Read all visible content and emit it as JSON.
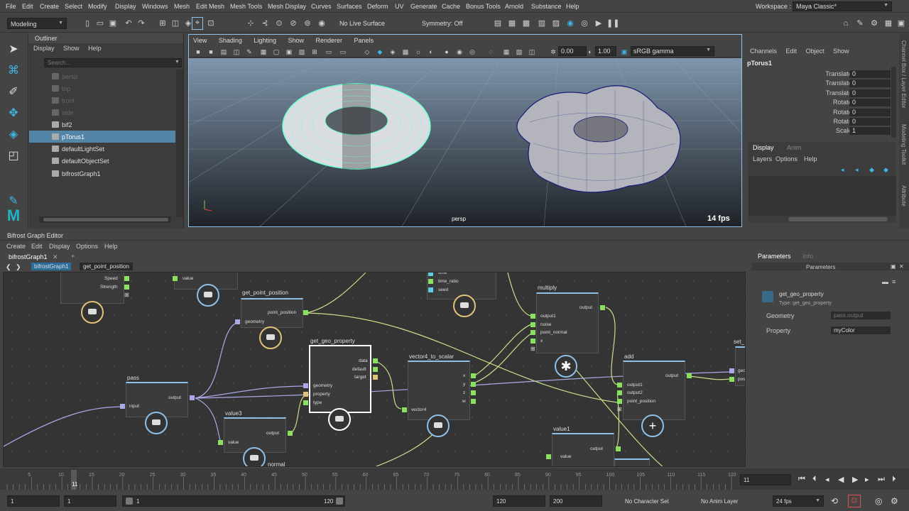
{
  "menubar": {
    "items": [
      "File",
      "Edit",
      "Create",
      "Select",
      "Modify",
      "Display",
      "Windows",
      "Mesh",
      "Edit Mesh",
      "Mesh Tools",
      "Mesh Display",
      "Curves",
      "Surfaces",
      "Deform",
      "UV",
      "Generate",
      "Cache",
      "Bonus Tools",
      "Arnold",
      "Substance",
      "Help"
    ],
    "workspace_label": "Workspace :",
    "workspace_value": "Maya Classic*"
  },
  "toolbar": {
    "mode": "Modeling",
    "live_surface": "No Live Surface",
    "symmetry": "Symmetry: Off"
  },
  "outliner": {
    "title": "Outliner",
    "menu": [
      "Display",
      "Show",
      "Help"
    ],
    "search_placeholder": "Search...",
    "items": [
      {
        "label": "persp",
        "dim": true
      },
      {
        "label": "top",
        "dim": true
      },
      {
        "label": "front",
        "dim": true
      },
      {
        "label": "side",
        "dim": true
      },
      {
        "label": "bif2",
        "dim": false
      },
      {
        "label": "pTorus1",
        "dim": false,
        "selected": true
      },
      {
        "label": "defaultLightSet",
        "dim": false
      },
      {
        "label": "defaultObjectSet",
        "dim": false
      },
      {
        "label": "bifrostGraph1",
        "dim": false
      }
    ]
  },
  "viewport": {
    "menu": [
      "View",
      "Shading",
      "Lighting",
      "Show",
      "Renderer",
      "Panels"
    ],
    "exposure": "0.00",
    "gamma": "1.00",
    "color_space": "sRGB gamma",
    "camera_label": "persp",
    "fps": "14 fps"
  },
  "channel_box": {
    "menu": [
      "Channels",
      "Edit",
      "Object",
      "Show"
    ],
    "object": "pTorus1",
    "channels": [
      {
        "label": "Translate X",
        "value": "0"
      },
      {
        "label": "Translate Y",
        "value": "0"
      },
      {
        "label": "Translate Z",
        "value": "0"
      },
      {
        "label": "Rotate X",
        "value": "0"
      },
      {
        "label": "Rotate Y",
        "value": "0"
      },
      {
        "label": "Rotate Z",
        "value": "0"
      },
      {
        "label": "Scale X",
        "value": "1"
      }
    ],
    "layer_tabs": [
      "Display",
      "Anim"
    ],
    "layer_menu": [
      "Layers",
      "Options",
      "Help"
    ],
    "side_tabs": [
      "Channel Box / Layer Editor",
      "Modeling Toolkit",
      "Attribute"
    ]
  },
  "bifrost": {
    "title": "Bifrost Graph Editor",
    "menu": [
      "Create",
      "Edit",
      "Display",
      "Options",
      "Help"
    ],
    "tab": "bifrostGraph1",
    "tab_add": "+",
    "breadcrumb": [
      "bifrostGraph1",
      "get_point_position"
    ],
    "nodes": {
      "n0_ports": [
        "Speed",
        "Strength"
      ],
      "value_port": "value",
      "get_point_position": {
        "title": "get_point_position",
        "out": "point_position",
        "in": "geometry"
      },
      "time_node": {
        "ports": [
          "time",
          "time_ratio",
          "seed"
        ]
      },
      "multiply": {
        "title": "multiply",
        "out": "output",
        "ins": [
          "output1",
          "noise",
          "point_normal",
          "x"
        ]
      },
      "get_geo_property": {
        "title": "get_geo_property",
        "outs": [
          "data",
          "default",
          "target"
        ],
        "ins": [
          "geometry",
          "property",
          "type"
        ]
      },
      "vector4_to_scalar": {
        "title": "vector4_to_scalar",
        "in": "vector4",
        "outs": [
          "x",
          "y",
          "z",
          "w"
        ]
      },
      "add": {
        "title": "add",
        "out": "output",
        "ins": [
          "output1",
          "output2",
          "point_position"
        ]
      },
      "set_node": {
        "title": "set_",
        "ports": [
          "geo",
          "pos"
        ]
      },
      "pass": {
        "title": "pass",
        "in": "input",
        "out": "output"
      },
      "value3": {
        "title": "value3",
        "in": "value",
        "out": "output"
      },
      "value1": {
        "title": "value1",
        "in": "value",
        "out": "output"
      },
      "normal": {
        "title": "normal"
      }
    }
  },
  "parameters": {
    "tabs": [
      "Parameters",
      "Info"
    ],
    "header": "Parameters",
    "node_name": "get_geo_property",
    "node_type": "Type: get_geo_property",
    "fields": [
      {
        "label": "Geometry",
        "value": "pass.output",
        "dim": true
      },
      {
        "label": "Property",
        "value": "myColor",
        "dim": false
      }
    ]
  },
  "timeline": {
    "ticks": [
      "5",
      "10",
      "15",
      "20",
      "25",
      "30",
      "35",
      "40",
      "45",
      "50",
      "55",
      "60",
      "65",
      "70",
      "75",
      "80",
      "85",
      "90",
      "95",
      "100",
      "105",
      "110",
      "115",
      "120"
    ],
    "current_frame_marker": "11",
    "current_frame": "11"
  },
  "range": {
    "start": "1",
    "start2": "1",
    "slider_start": "1",
    "slider_end": "120",
    "end": "120",
    "end2": "200",
    "character_set": "No Character Set",
    "anim_layer": "No Anim Layer",
    "fps": "24 fps"
  }
}
